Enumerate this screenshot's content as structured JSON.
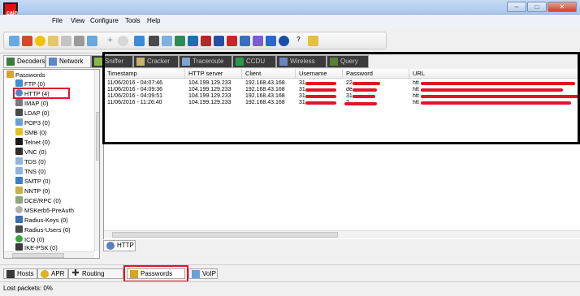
{
  "window": {
    "min_glyph": "‒",
    "max_glyph": "□",
    "close_glyph": "✕"
  },
  "menu": {
    "items": [
      "File",
      "View",
      "Configure",
      "Tools",
      "Help"
    ]
  },
  "top_tabs": [
    {
      "label": "Decoders",
      "icon": "decoder-icon"
    },
    {
      "label": "Network",
      "icon": "network-icon"
    },
    {
      "label": "Sniffer",
      "icon": "sniffer-icon"
    },
    {
      "label": "Cracker",
      "icon": "cracker-icon"
    },
    {
      "label": "Traceroute",
      "icon": "traceroute-icon"
    },
    {
      "label": "CCDU",
      "icon": "ccdu-icon"
    },
    {
      "label": "Wireless",
      "icon": "wireless-icon"
    },
    {
      "label": "Query",
      "icon": "query-icon"
    }
  ],
  "tree": {
    "items": [
      {
        "label": "Passwords",
        "icon": "key-icon"
      },
      {
        "label": "FTP (0)",
        "icon": "ftp-icon"
      },
      {
        "label": "HTTP (4)",
        "icon": "http-icon"
      },
      {
        "label": "IMAP (0)",
        "icon": "imap-icon"
      },
      {
        "label": "LDAP (0)",
        "icon": "ldap-icon"
      },
      {
        "label": "POP3 (0)",
        "icon": "pop3-icon"
      },
      {
        "label": "SMB (0)",
        "icon": "smb-icon"
      },
      {
        "label": "Telnet (0)",
        "icon": "telnet-icon"
      },
      {
        "label": "VNC (0)",
        "icon": "vnc-icon"
      },
      {
        "label": "TDS (0)",
        "icon": "tds-icon"
      },
      {
        "label": "TNS (0)",
        "icon": "tns-icon"
      },
      {
        "label": "SMTP (0)",
        "icon": "smtp-icon"
      },
      {
        "label": "NNTP (0)",
        "icon": "nntp-icon"
      },
      {
        "label": "DCE/RPC (0)",
        "icon": "dcerpc-icon"
      },
      {
        "label": "MSKerb5-PreAuth",
        "icon": "kerberos-icon"
      },
      {
        "label": "Radius-Keys (0)",
        "icon": "radius-keys-icon"
      },
      {
        "label": "Radius-Users (0)",
        "icon": "radius-users-icon"
      },
      {
        "label": "ICQ (0)",
        "icon": "icq-icon"
      },
      {
        "label": "IKE-PSK (0)",
        "icon": "ike-icon"
      }
    ]
  },
  "table": {
    "columns": [
      "Timestamp",
      "HTTP server",
      "Client",
      "Username",
      "Password",
      "URL"
    ],
    "rows": [
      {
        "timestamp": "11/06/2016 - 04:07:46",
        "server": "104.199.129.233",
        "client": "192.168.43.168",
        "username": "31",
        "password": "22",
        "url": "htt"
      },
      {
        "timestamp": "11/06/2016 - 04:09:36",
        "server": "104.199.129.233",
        "client": "192.168.43.168",
        "username": "31",
        "password": "de",
        "url": "htt"
      },
      {
        "timestamp": "11/06/2016 - 04:09:51",
        "server": "104.199.129.233",
        "client": "192.168.43.168",
        "username": "31",
        "password": "31",
        "url": "htt"
      },
      {
        "timestamp": "11/06/2016 - 11:26:40",
        "server": "104.199.129.233",
        "client": "192.168.43.168",
        "username": "31",
        "password": "2",
        "url": "htt"
      }
    ]
  },
  "subtab": {
    "label": "HTTP",
    "icon": "http-icon"
  },
  "bottom_tabs": [
    {
      "label": "Hosts",
      "icon": "hosts-icon"
    },
    {
      "label": "APR",
      "icon": "apr-icon"
    },
    {
      "label": "Routing",
      "icon": "routing-icon"
    },
    {
      "label": "Passwords",
      "icon": "key-icon"
    },
    {
      "label": "VoIP",
      "icon": "voip-icon"
    }
  ],
  "status": {
    "text": "Lost packets:  0%"
  },
  "colors": {
    "highlight": "#e0152a",
    "selection_border": "#000000",
    "titlebar": "#a9c7ec"
  }
}
